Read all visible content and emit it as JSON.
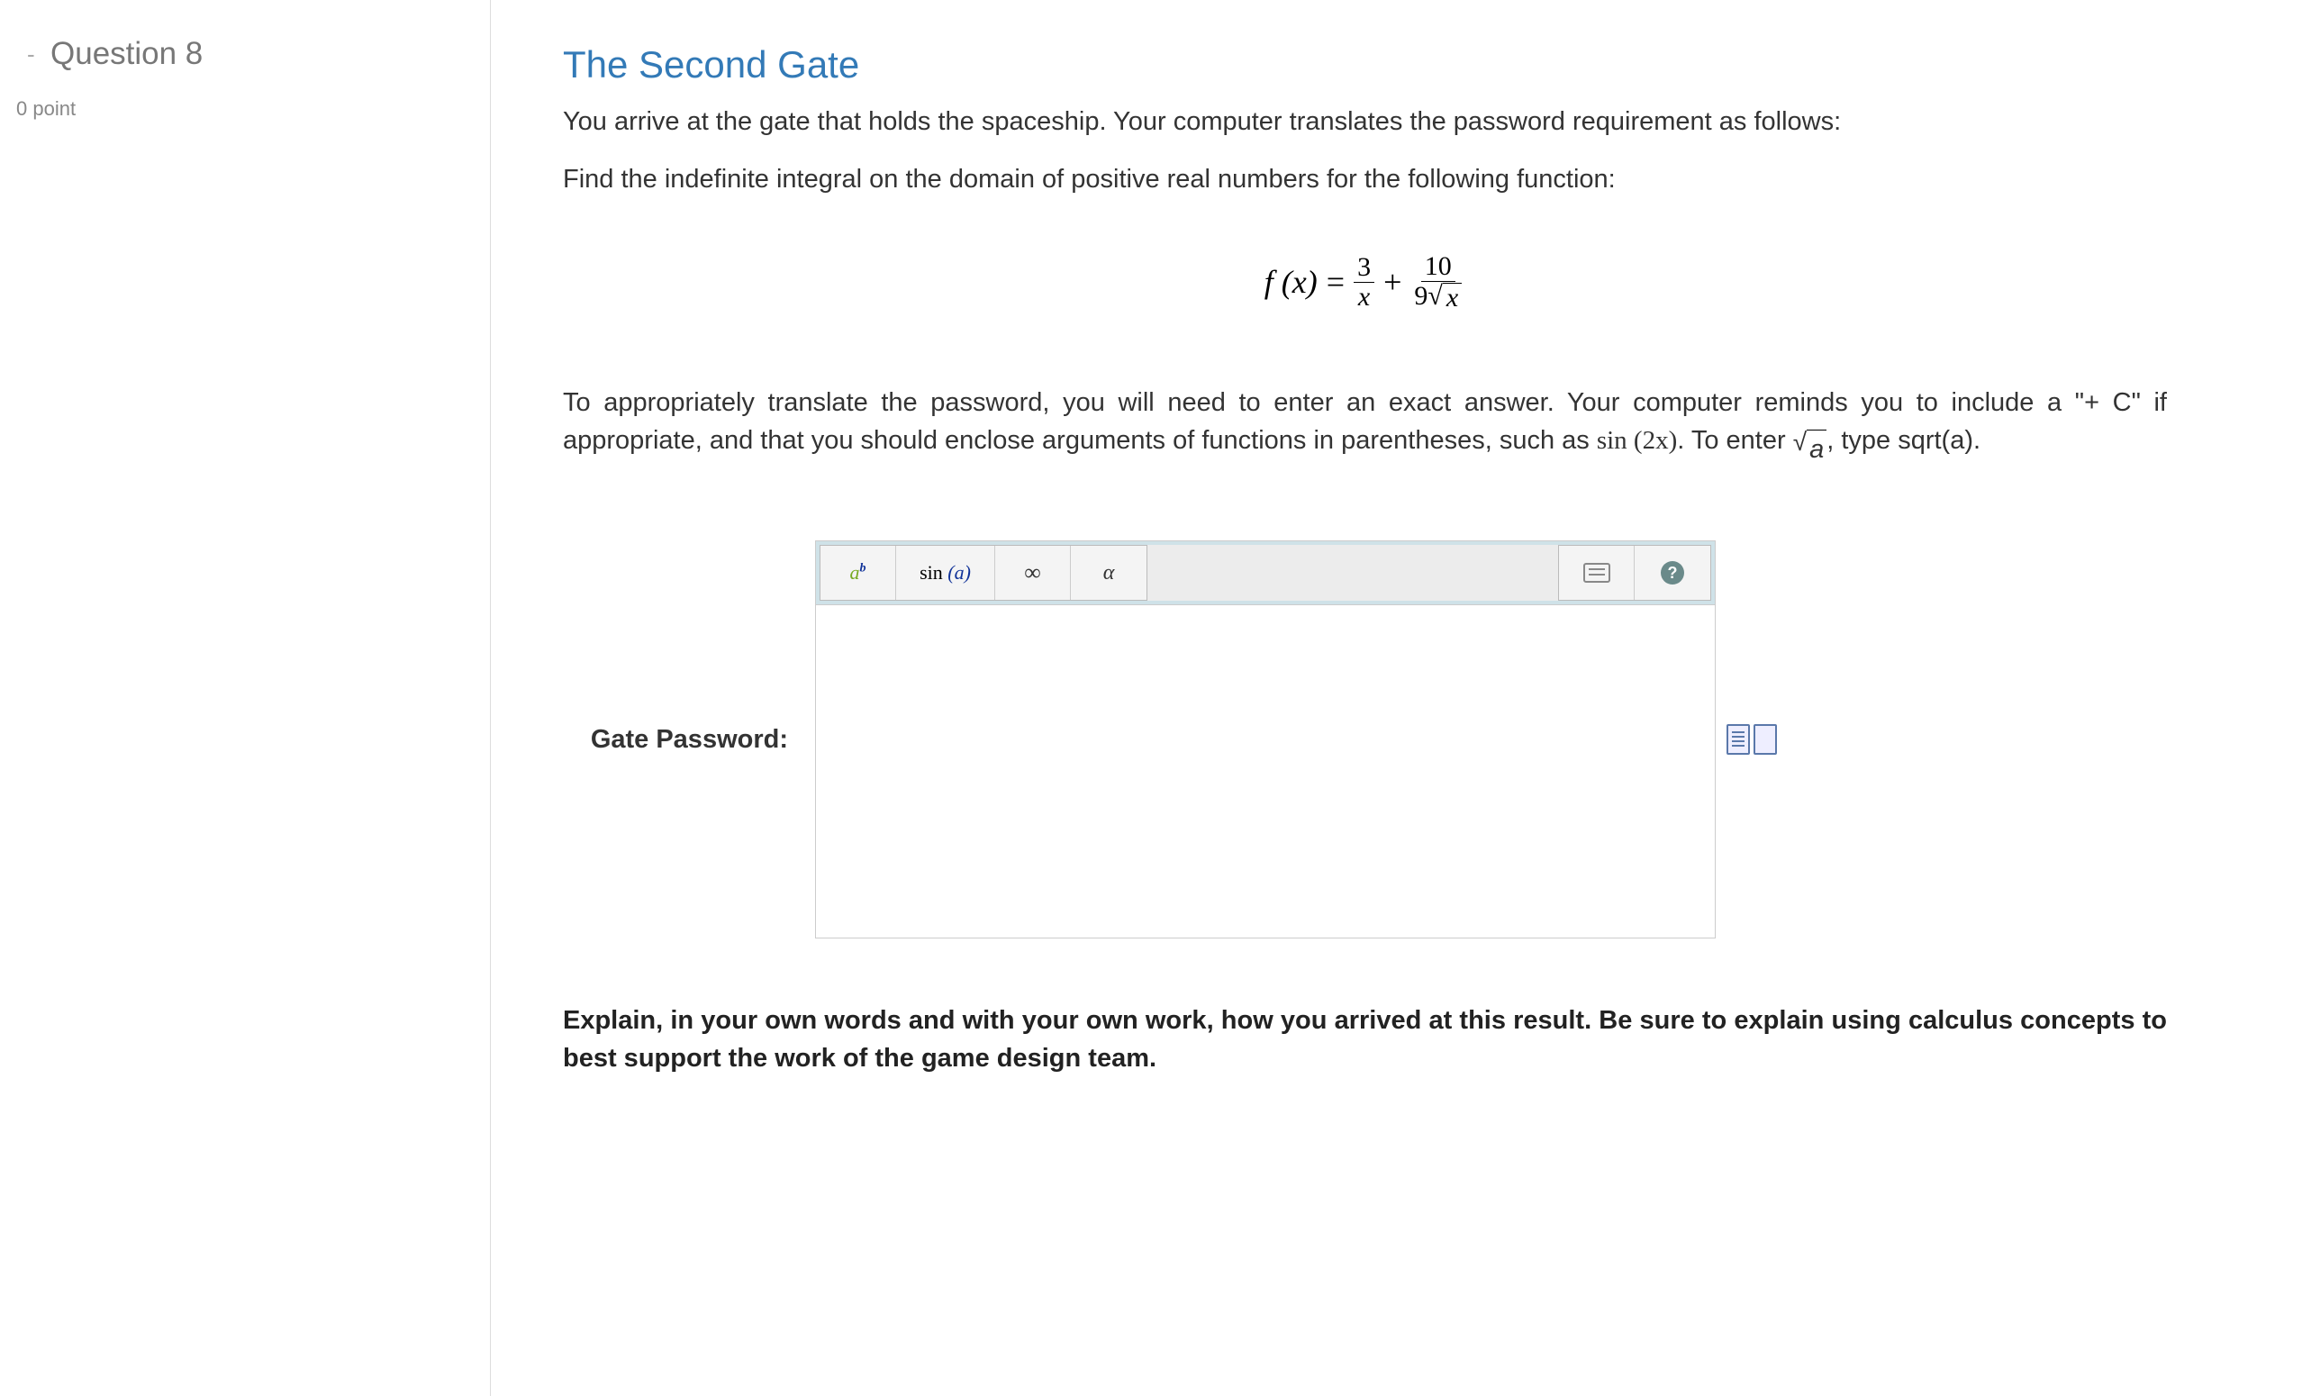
{
  "sidebar": {
    "question_label": "Question 8",
    "points_label": "0 point"
  },
  "content": {
    "heading": "The Second Gate",
    "intro": "You arrive at the gate that holds the spaceship. Your computer translates the password requirement as follows:",
    "instruction": "Find the indefinite integral on the domain of positive real numbers for the following function:",
    "formula": {
      "lhs": "f (x)",
      "eq": "=",
      "frac1_num": "3",
      "frac1_den": "x",
      "plus": "+",
      "frac2_num": "10",
      "frac2_den_coeff": "9",
      "frac2_den_radicand": "x"
    },
    "note_pre": "To appropriately translate the password, you will need to enter an exact answer. Your computer reminds you to include a \"+ C\" if appropriate, and that you should enclose arguments of functions in parentheses, such as ",
    "note_math_sin": "sin (2x)",
    "note_mid": ". To enter ",
    "note_math_sqrt_radicand": "a",
    "note_post": ", type sqrt(a).",
    "answer_label": "Gate Password:",
    "toolbar": {
      "ab_base": "a",
      "ab_exp": "b",
      "sin_fn": "sin",
      "sin_arg": "(a)",
      "infinity": "∞",
      "alpha": "α",
      "help": "?"
    },
    "input_value": "",
    "explain": "Explain, in your own words and with your own work, how you arrived at this result. Be sure to explain using calculus concepts to best support the work of the game design team."
  }
}
